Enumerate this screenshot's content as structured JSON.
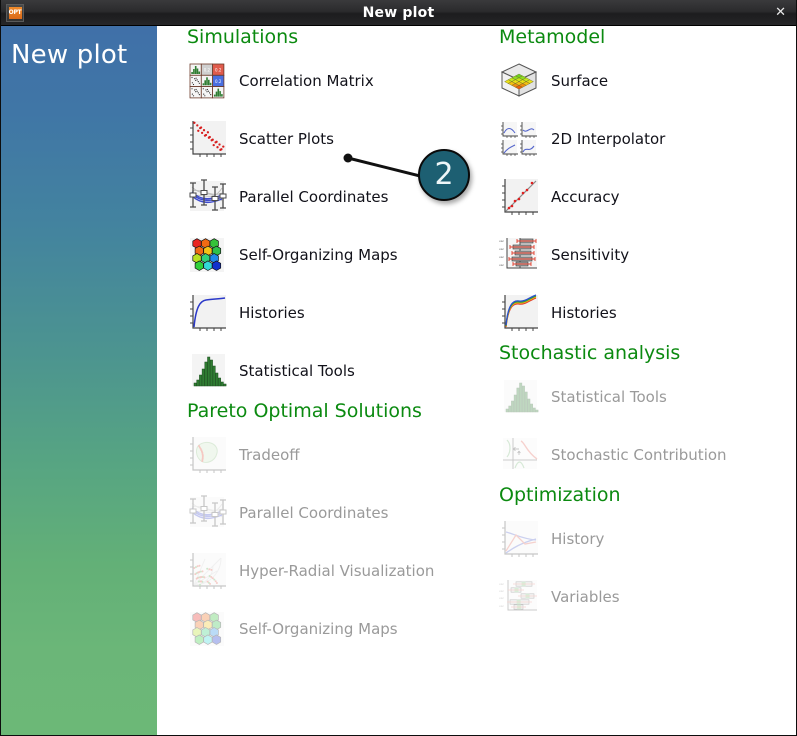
{
  "window": {
    "title": "New plot",
    "icon": "app-opt-icon",
    "icon_text": "OPT",
    "close_label": "✕"
  },
  "sidebar": {
    "title": "New plot",
    "gradient_top": "#4070a8",
    "gradient_bottom": "#6cb877"
  },
  "theme": {
    "section_heading_color": "#0b8a10",
    "label_color": "#12121a",
    "disabled_label_color": "#9a9a9a",
    "badge_fill": "#1d5f72",
    "badge_text": "#eef6f8"
  },
  "annotation": {
    "badge_number": "2",
    "points_to": "Scatter Plots"
  },
  "columns": [
    {
      "name": "left",
      "sections": [
        {
          "heading": "Simulations",
          "items": [
            {
              "label": "Correlation Matrix",
              "icon": "correlation-matrix-icon",
              "enabled": true
            },
            {
              "label": "Scatter Plots",
              "icon": "scatter-plot-icon",
              "enabled": true
            },
            {
              "label": "Parallel Coordinates",
              "icon": "parallel-coordinates-icon",
              "enabled": true
            },
            {
              "label": "Self-Organizing Maps",
              "icon": "self-organizing-map-icon",
              "enabled": true
            },
            {
              "label": "Histories",
              "icon": "history-curve-icon",
              "enabled": true
            },
            {
              "label": "Statistical Tools",
              "icon": "histogram-icon",
              "enabled": true
            }
          ]
        },
        {
          "heading": "Pareto Optimal Solutions",
          "items": [
            {
              "label": "Tradeoff",
              "icon": "tradeoff-icon",
              "enabled": false
            },
            {
              "label": "Parallel Coordinates",
              "icon": "parallel-coordinates-icon",
              "enabled": false
            },
            {
              "label": "Hyper-Radial Visualization",
              "icon": "hyper-radial-icon",
              "enabled": false
            },
            {
              "label": "Self-Organizing Maps",
              "icon": "self-organizing-map-icon",
              "enabled": false
            }
          ]
        }
      ]
    },
    {
      "name": "right",
      "sections": [
        {
          "heading": "Metamodel",
          "items": [
            {
              "label": "Surface",
              "icon": "surface-3d-icon",
              "enabled": true
            },
            {
              "label": "2D Interpolator",
              "icon": "interpolator-2d-icon",
              "enabled": true
            },
            {
              "label": "Accuracy",
              "icon": "accuracy-scatter-icon",
              "enabled": true
            },
            {
              "label": "Sensitivity",
              "icon": "sensitivity-bars-icon",
              "enabled": true
            },
            {
              "label": "Histories",
              "icon": "history-multi-icon",
              "enabled": true
            }
          ]
        },
        {
          "heading": "Stochastic analysis",
          "items": [
            {
              "label": "Statistical Tools",
              "icon": "histogram-icon",
              "enabled": false
            },
            {
              "label": "Stochastic Contribution",
              "icon": "stochastic-contribution-icon",
              "enabled": false
            }
          ]
        },
        {
          "heading": "Optimization",
          "items": [
            {
              "label": "History",
              "icon": "optimization-history-icon",
              "enabled": false
            },
            {
              "label": "Variables",
              "icon": "variables-bars-icon",
              "enabled": false
            }
          ]
        }
      ]
    }
  ]
}
